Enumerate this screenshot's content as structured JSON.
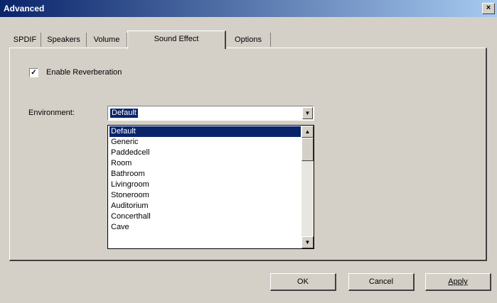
{
  "window": {
    "title": "Advanced",
    "close_glyph": "×"
  },
  "tabs": [
    {
      "label": "SPDIF"
    },
    {
      "label": "Speakers"
    },
    {
      "label": "Volume"
    },
    {
      "label": "Sound Effect",
      "active": true
    },
    {
      "label": "Options"
    }
  ],
  "reverb": {
    "label": "Enable Reverberation",
    "checked": true,
    "check_glyph": "✓"
  },
  "environment": {
    "label": "Environment:",
    "selected": "Default",
    "arrow_glyph": "▼",
    "options": [
      "Default",
      "Generic",
      "Paddedcell",
      "Room",
      "Bathroom",
      "Livingroom",
      "Stoneroom",
      "Auditorium",
      "Concerthall",
      "Cave"
    ],
    "scroll_up_glyph": "▲",
    "scroll_down_glyph": "▼"
  },
  "buttons": {
    "ok": "OK",
    "cancel": "Cancel",
    "apply": "Apply"
  },
  "colors": {
    "selection": "#0a246a",
    "face": "#d4d0c8",
    "title_start": "#0a246a",
    "title_end": "#a6caf0"
  }
}
